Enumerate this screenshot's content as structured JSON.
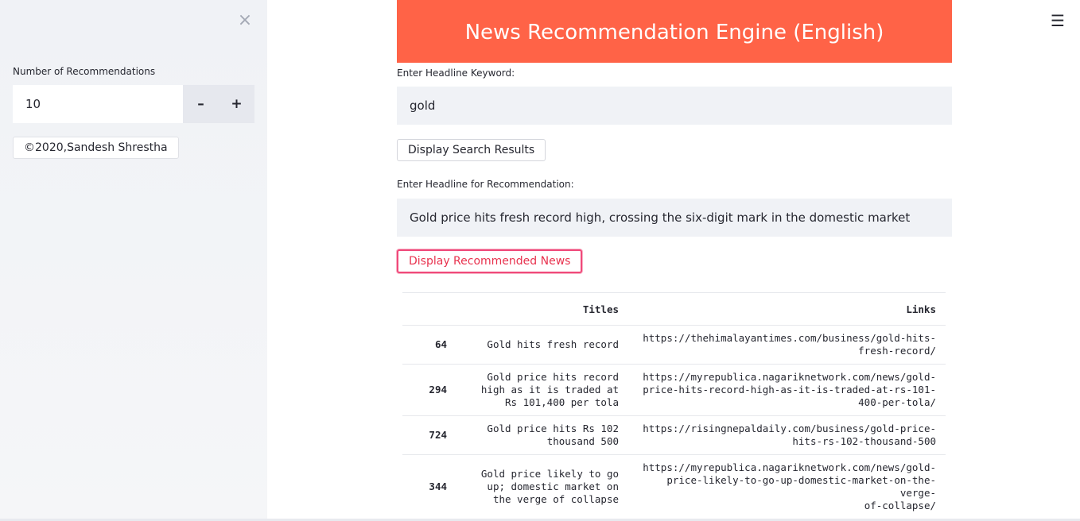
{
  "sidebar": {
    "close_icon": "close-icon",
    "recommendations_label": "Number of Recommendations",
    "recommendations_value": "10",
    "minus_label": "–",
    "plus_label": "+",
    "copyright": "©2020,Sandesh Shrestha"
  },
  "menu_icon": "hamburger-menu-icon",
  "header": {
    "title": "News Recommendation Engine (English)",
    "banner_color": "#ff6347"
  },
  "keyword": {
    "label": "Enter Headline Keyword:",
    "value": "gold"
  },
  "search_button": "Display Search Results",
  "recommendation": {
    "label": "Enter Headline for Recommendation:",
    "value": "Gold price hits fresh record high, crossing the six-digit mark in the domestic market"
  },
  "recommend_button": "Display Recommended News",
  "accent_color": "#f0497a",
  "table": {
    "columns": [
      "",
      "Titles",
      "Links"
    ],
    "rows": [
      {
        "index": "64",
        "title": [
          "Gold hits fresh record"
        ],
        "link": [
          "https://thehimalayantimes.com/business/gold-hits-",
          "fresh-record/"
        ]
      },
      {
        "index": "294",
        "title": [
          "Gold price hits record",
          "high as it is traded at",
          "Rs 101,400 per tola"
        ],
        "link": [
          "https://myrepublica.nagariknetwork.com/news/gold-",
          "price-hits-record-high-as-it-is-traded-at-rs-101-",
          "400-per-tola/"
        ]
      },
      {
        "index": "724",
        "title": [
          "Gold price hits Rs 102",
          "thousand 500"
        ],
        "link": [
          "https://risingnepaldaily.com/business/gold-price-",
          "hits-rs-102-thousand-500"
        ]
      },
      {
        "index": "344",
        "title": [
          "Gold price likely to go",
          "up; domestic market on",
          "the verge of collapse"
        ],
        "link": [
          "https://myrepublica.nagariknetwork.com/news/gold-",
          "price-likely-to-go-up-domestic-market-on-the-verge-",
          "of-collapse/"
        ]
      }
    ]
  }
}
